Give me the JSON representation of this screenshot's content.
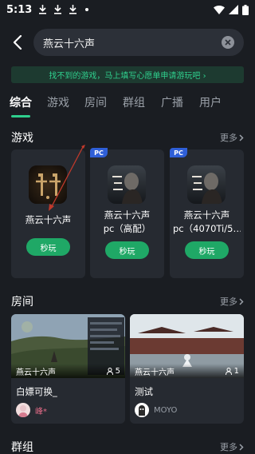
{
  "status_bar": {
    "time": "5:13"
  },
  "search": {
    "query": "燕云十六声"
  },
  "banner": {
    "text": "找不到的游戏，马上填写心愿单申请游玩吧 ›"
  },
  "tabs": [
    {
      "label": "综合",
      "active": true
    },
    {
      "label": "游戏"
    },
    {
      "label": "房间"
    },
    {
      "label": "群组"
    },
    {
      "label": "广播"
    },
    {
      "label": "用户"
    }
  ],
  "sections": {
    "games": {
      "title": "游戏",
      "more": "更多"
    },
    "rooms": {
      "title": "房间",
      "more": "更多"
    },
    "groups": {
      "title": "群组",
      "more": "更多"
    }
  },
  "games": [
    {
      "name": "燕云十六声",
      "badge": "",
      "button": "秒玩"
    },
    {
      "name": "燕云十六声",
      "name2": "pc（高配）",
      "badge": "PC",
      "button": "秒玩"
    },
    {
      "name": "燕云十六声",
      "name2": "pc（4070Ti/5…",
      "badge": "PC",
      "button": "秒玩"
    }
  ],
  "rooms": [
    {
      "game": "燕云十六声",
      "count": "5",
      "title": "白嫖可换_",
      "user": "峰*"
    },
    {
      "game": "燕云十六声",
      "count": "1",
      "title": "测试",
      "user": "MOYO"
    }
  ],
  "colors": {
    "accent": "#2fcf8d",
    "button": "#1fa866",
    "pc_badge": "#2f5fd7"
  }
}
